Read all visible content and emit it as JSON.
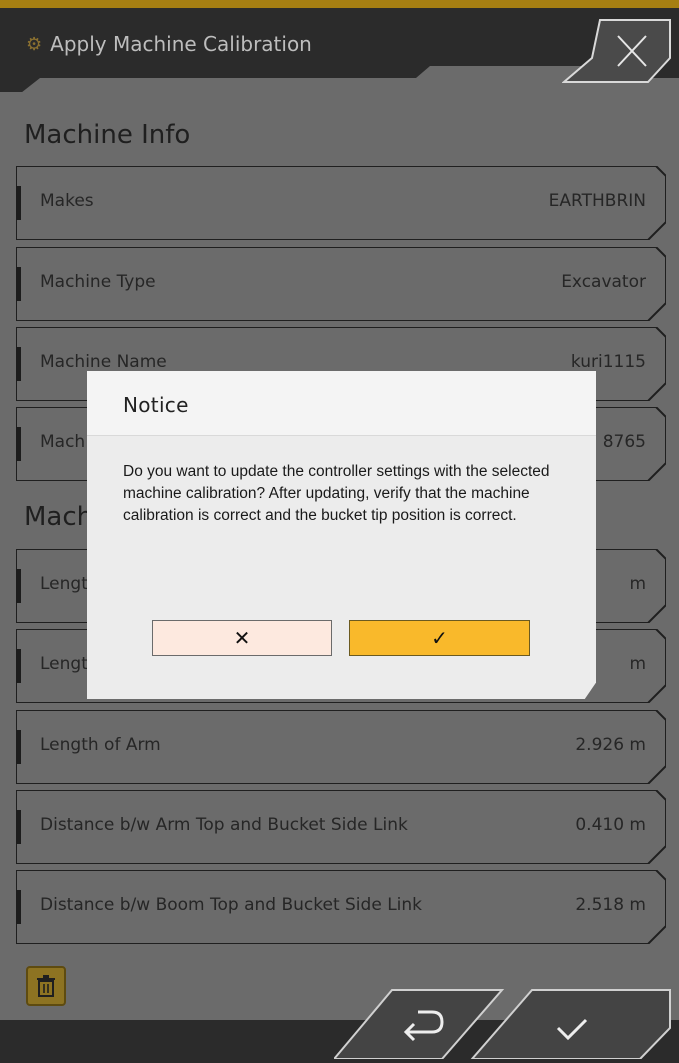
{
  "header": {
    "title": "Apply Machine Calibration",
    "gear_icon": "gear-icon",
    "close_icon": "close-icon"
  },
  "machine_info": {
    "title": "Machine Info",
    "rows": [
      {
        "label": "Makes",
        "value": "EARTHBRIN"
      },
      {
        "label": "Machine Type",
        "value": "Excavator"
      },
      {
        "label": "Machine Name",
        "value": "kuri1115"
      },
      {
        "label": "Mach",
        "value": "8765"
      }
    ]
  },
  "machine_dims": {
    "title": "Mach",
    "rows": [
      {
        "label": "Lengt",
        "value": "m"
      },
      {
        "label": "Lengt",
        "value": "m"
      },
      {
        "label": "Length of Arm",
        "value": "2.926 m"
      },
      {
        "label": "Distance b/w Arm Top and Bucket Side Link",
        "value": "0.410 m"
      },
      {
        "label": "Distance b/w Boom Top and Bucket Side Link",
        "value": "2.518 m"
      }
    ]
  },
  "footer": {
    "trash_icon": "trash-icon",
    "back_icon": "return-arrow-icon",
    "confirm_icon": "checkmark-icon"
  },
  "modal": {
    "title": "Notice",
    "message": "Do you want to update the controller settings with the selected machine calibration? After updating, verify that the machine calibration is correct and the bucket tip position is correct.",
    "cancel_label": "✕",
    "ok_label": "✓"
  },
  "colors": {
    "accent": "#f9b92b",
    "background": "#6b6b6b",
    "header": "#2b2b2b",
    "cancel_bg": "#fde9df"
  }
}
